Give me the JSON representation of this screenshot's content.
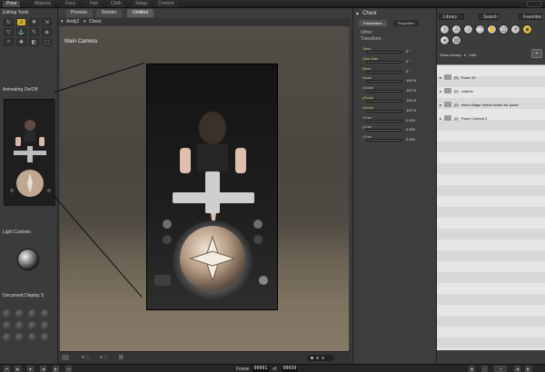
{
  "rooms": [
    "Pose",
    "Material",
    "Face",
    "Hair",
    "Cloth",
    "Setup",
    "Content"
  ],
  "left": {
    "editing_tools_title": "Editing Tools",
    "animating_title": "Animating On/Off",
    "light_controls_title": "Light Controls",
    "document_display_title": "Document Display S"
  },
  "viewport": {
    "tabs": [
      "Preview",
      "Render",
      "Untitled"
    ],
    "figure": "Andy2",
    "part": "Chest",
    "camera": "Main Camera",
    "frame_label": "Frame",
    "frame_current": "00001",
    "frame_total": "00030"
  },
  "params": {
    "title": "Chest",
    "tabs": [
      "Parameters",
      "Properties"
    ],
    "links": [
      "Other",
      "Transform"
    ],
    "dials": [
      {
        "label": "Twist",
        "value": "0 °"
      },
      {
        "label": "Side-Side",
        "value": "0 °"
      },
      {
        "label": "Bend",
        "value": "0 °"
      },
      {
        "label": "Scale",
        "value": "100 %"
      },
      {
        "label": "xScale",
        "value": "100 %"
      },
      {
        "label": "yScale",
        "value": "100 %"
      },
      {
        "label": "zScale",
        "value": "100 %"
      },
      {
        "label": "xTran",
        "value": "0.000"
      },
      {
        "label": "yTran",
        "value": "0.000"
      },
      {
        "label": "zTran",
        "value": "0.000"
      }
    ]
  },
  "library": {
    "tabs": [
      "Library",
      "Search",
      "Favorites"
    ],
    "show_label": "Show Library:",
    "show_value": "<All>",
    "items": [
      {
        "count": "[5]",
        "name": "Poser 10"
      },
      {
        "count": "[0]",
        "name": "runtime"
      },
      {
        "count": "[0]",
        "name": "elven village herbal healer for poser"
      },
      {
        "count": "[0]",
        "name": "Poser Content 2"
      }
    ]
  },
  "colors": {
    "accent": "#d7b12a",
    "dial_label": "#b9d27a"
  }
}
